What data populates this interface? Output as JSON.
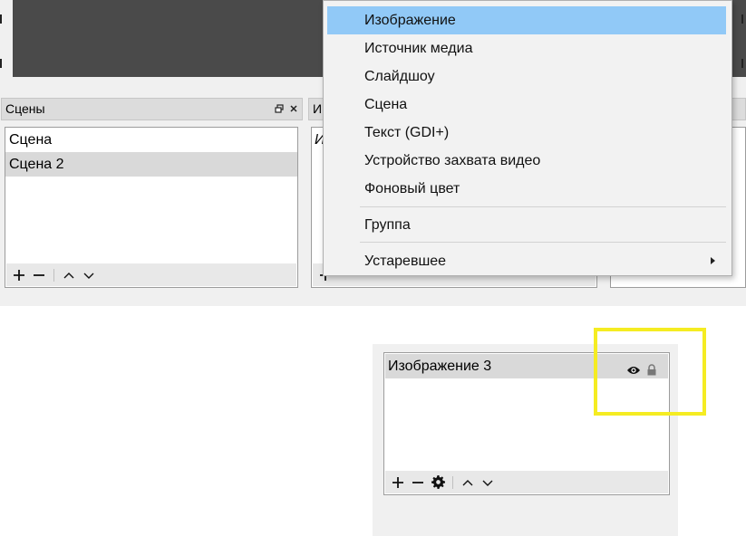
{
  "scenes_dock": {
    "title": "Сцены",
    "scenes": [
      {
        "label": "Сцена",
        "selected": false
      },
      {
        "label": "Сцена 2",
        "selected": true
      }
    ]
  },
  "sources_dock": {
    "title_partial": "И",
    "header_partial": "И"
  },
  "context_menu": {
    "items": [
      {
        "label": "Изображение",
        "highlighted": true
      },
      {
        "label": "Источник медиа"
      },
      {
        "label": "Слайдшоу"
      },
      {
        "label": "Сцена"
      },
      {
        "label": "Текст (GDI+)"
      },
      {
        "label": "Устройство захвата видео"
      },
      {
        "label": "Фоновый цвет"
      }
    ],
    "group_label": "Группа",
    "deprecated_label": "Устаревшее"
  },
  "sources_zoom": {
    "source_name": "Изображение 3",
    "icons": [
      "eye-icon",
      "lock-icon"
    ]
  },
  "colors": {
    "menu_highlight": "#91c9f7",
    "annotation_box": "#f5ec22",
    "preview_bg": "#4a4a4a"
  }
}
